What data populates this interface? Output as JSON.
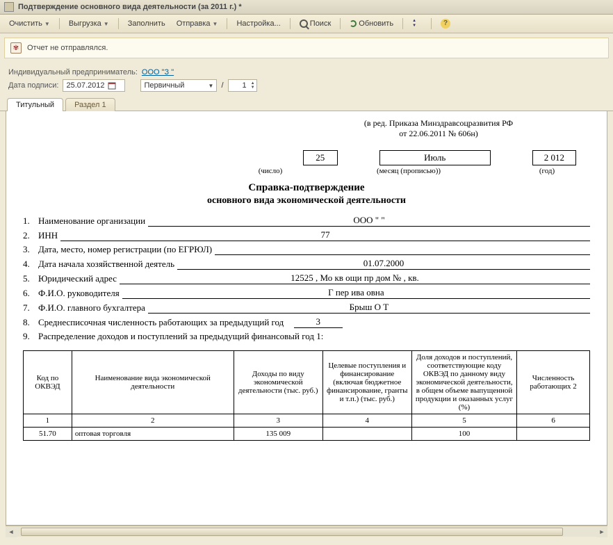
{
  "window": {
    "title": "Подтверждение основного вида деятельности  (за 2011 г.) *"
  },
  "toolbar": {
    "clear": "Очистить",
    "export": "Выгрузка",
    "fill": "Заполнить",
    "send": "Отправка",
    "setup": "Настройка...",
    "search": "Поиск",
    "refresh": "Обновить"
  },
  "status": {
    "text": "Отчет не отправлялся."
  },
  "header": {
    "ip_label": "Индивидуальный предприниматель:",
    "ip_value": "ООО \"З                         \"",
    "sign_date_label": "Дата подписи:",
    "sign_date": "25.07.2012",
    "report_kind": "Первичный",
    "report_num": "1"
  },
  "tabs": {
    "t1": "Титульный",
    "t2": "Раздел 1"
  },
  "doc": {
    "edict1": "(в ред. Приказа Минздравсоцразвития РФ",
    "edict2": "от 22.06.2011 № 606н)",
    "day": "25",
    "month": "Июль",
    "year": "2 012",
    "day_lbl": "(число)",
    "month_lbl": "(месяц (прописью))",
    "year_lbl": "(год)",
    "title": "Справка-подтверждение",
    "subtitle": "основного вида экономической деятельности",
    "l1": "Наименование организации",
    "l1v": "ООО \"                              \"",
    "l2": "ИНН",
    "l2v": "77                 ",
    "l3": "Дата, место, номер регистрации (по ЕГРЮЛ)",
    "l3v": "                                          ",
    "l4": "Дата начала хозяйственной деятель",
    "l4v": "01.07.2000",
    "l5": "Юридический адрес",
    "l5v": "12525 , Мо кв                 ощи пр         дом №   , кв.   ",
    "l6": "Ф.И.О. руководителя",
    "l6v": "Г        пер ива  овна",
    "l7": "Ф.И.О. главного бухгалтера",
    "l7v": "Брыш О        Т           ",
    "l8": "Среднесписочная численность работающих за предыдущий год",
    "l8v": "3",
    "l9": "Распределение доходов и поступлений за предыдущий финансовый год 1:",
    "th1": "Код по ОКВЭД",
    "th2": "Наименование вида экономической деятельности",
    "th3": "Доходы по виду экономической деятельности (тыс. руб.)",
    "th4": "Целевые поступления и финансирование (включая бюджетное финансирование, гранты и т.п.) (тыс. руб.)",
    "th5": "Доля доходов и поступлений, соответствующие коду ОКВЭД по данному виду экономической деятельности, в общем объеме выпущенной продукции и оказанных услуг (%)",
    "th6": "Численность работающих 2",
    "hn1": "1",
    "hn2": "2",
    "hn3": "3",
    "hn4": "4",
    "hn5": "5",
    "hn6": "6",
    "r1c1": "51.70",
    "r1c2": "оптовая торговля",
    "r1c3": "135 009",
    "r1c4": "",
    "r1c5": "100",
    "r1c6": ""
  }
}
